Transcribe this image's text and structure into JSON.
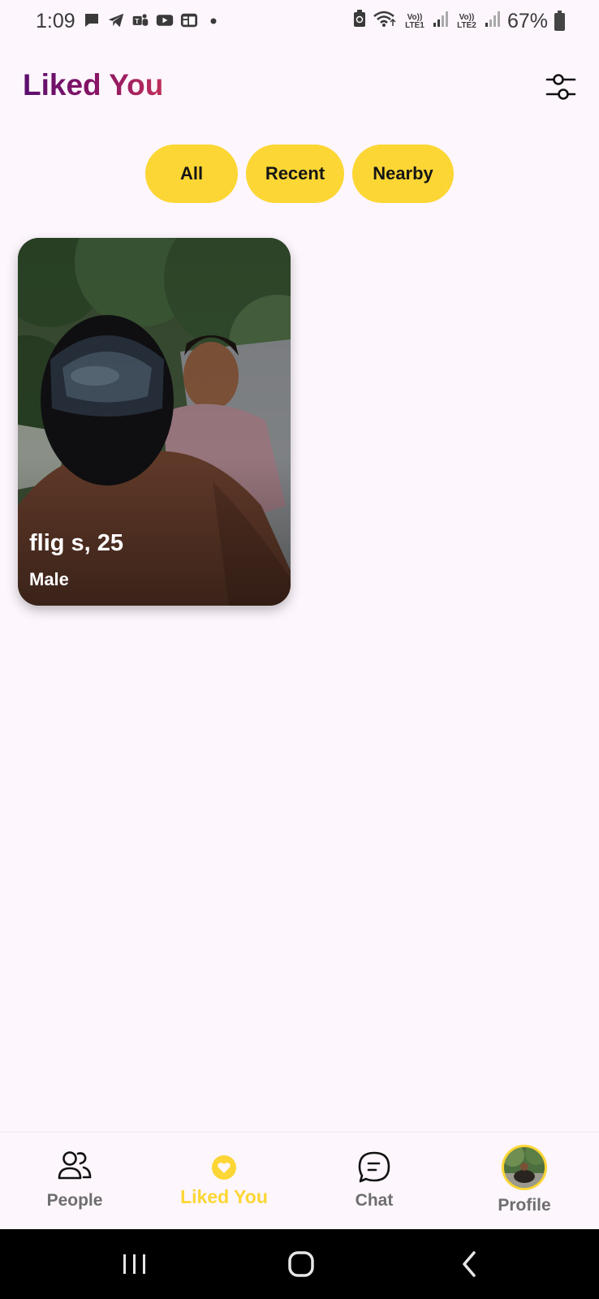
{
  "status_bar": {
    "time": "1:09",
    "battery": "67%",
    "left_icons": [
      "message-icon",
      "telegram-icon",
      "teams-icon",
      "youtube-icon",
      "news-icon",
      "dot-icon"
    ],
    "right_icons": [
      "battery-saver-icon",
      "wifi-icon",
      "volte-lte1-icon",
      "signal-icon",
      "volte-lte2-icon",
      "signal-icon",
      "battery-icon"
    ],
    "sim1_label": "Vo)) LTE1",
    "sim2_label": "Vo)) LTE2"
  },
  "header": {
    "title": "Liked You",
    "filter_icon": "filter-sliders-icon"
  },
  "filters": {
    "chips": [
      "All",
      "Recent",
      "Nearby"
    ],
    "accent": "#fcd634"
  },
  "cards": [
    {
      "name_age": "flig s, 25",
      "gender": "Male"
    }
  ],
  "bottom_nav": {
    "items": [
      {
        "label": "People",
        "icon": "people-icon"
      },
      {
        "label": "Liked You",
        "icon": "heart-icon",
        "active": true
      },
      {
        "label": "Chat",
        "icon": "chat-icon"
      },
      {
        "label": "Profile",
        "icon": "avatar"
      }
    ],
    "active_color": "#fcd634"
  },
  "system_nav": {
    "buttons": [
      "recents-icon",
      "home-icon",
      "back-icon"
    ]
  }
}
